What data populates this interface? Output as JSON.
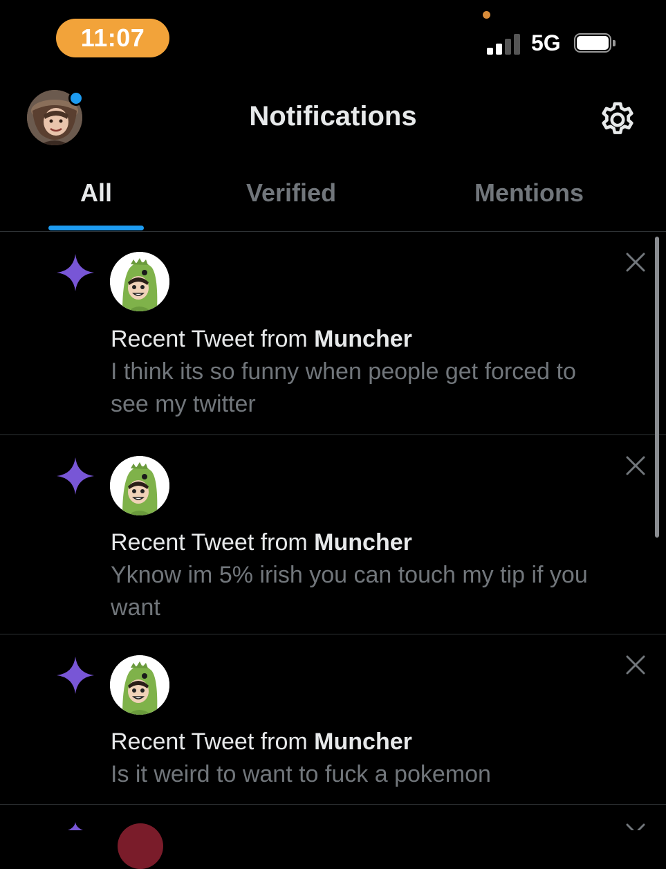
{
  "status_bar": {
    "time": "11:07",
    "network": "5G",
    "signal_bars_active": 2,
    "signal_bars_total": 4,
    "battery_level": 0.9,
    "colors": {
      "time_pill": "#f2a33a",
      "privacy_dot": "#d98c3a"
    }
  },
  "header": {
    "title": "Notifications",
    "avatar_icon": "user-avatar",
    "settings_icon": "gear-icon"
  },
  "tabs": [
    {
      "label": "All",
      "active": true
    },
    {
      "label": "Verified",
      "active": false
    },
    {
      "label": "Mentions",
      "active": false
    }
  ],
  "notifications": [
    {
      "prefix": "Recent Tweet from ",
      "author": "Muncher",
      "text_lines": [
        "I think its so funny when people get forced to",
        "see my twitter"
      ],
      "icon": "sparkle-icon"
    },
    {
      "prefix": "Recent Tweet from ",
      "author": "Muncher",
      "text_lines": [
        "Yknow im 5% irish you can touch my tip if you",
        "want"
      ],
      "icon": "sparkle-icon"
    },
    {
      "prefix": "Recent Tweet from ",
      "author": "Muncher",
      "text_lines": [
        "Is it weird to want to fuck a pokemon"
      ],
      "icon": "sparkle-icon"
    }
  ],
  "colors": {
    "accent": "#1d9bf0",
    "sparkle": "#7856d6",
    "background": "#000000",
    "secondary_text": "#71767b",
    "divider": "#2f3336"
  }
}
